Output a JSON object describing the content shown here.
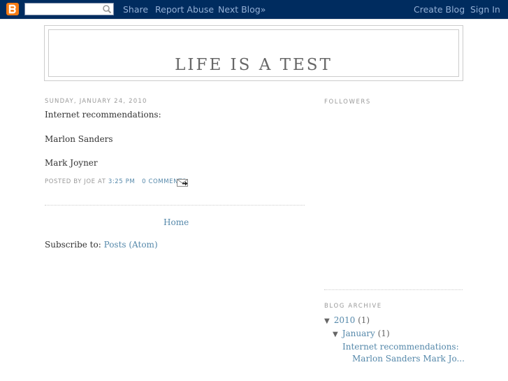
{
  "navbar": {
    "logo_icon": "blogger-logo-icon",
    "search": {
      "value": "",
      "placeholder": "",
      "icon": "search-icon"
    },
    "links": [
      "Share",
      "Report Abuse",
      "Next Blog»"
    ],
    "right_links": [
      "Create Blog",
      "Sign In"
    ],
    "colors": {
      "background": "#002c5f",
      "link": "#94b0d6",
      "logo": "#f47b14"
    }
  },
  "header": {
    "title": "LIFE IS A TEST"
  },
  "post": {
    "date": "Sunday, January 24, 2010",
    "lines": [
      "Internet recommendations:",
      "Marlon Sanders",
      "Mark Joyner"
    ],
    "footer": {
      "posted_by": "Posted by Joe at",
      "time": "3:25 PM",
      "comments": "0 Comments",
      "email_icon": "email-post-icon"
    }
  },
  "home_link": "Home",
  "subscribe": {
    "label": "Subscribe to:",
    "link": "Posts (Atom)"
  },
  "sidebar": {
    "followers_title": "Followers",
    "archive_title": "Blog Archive",
    "archive": {
      "year": "2010",
      "year_count": "(1)",
      "month": "January",
      "month_count": "(1)",
      "toggle_icon": "▼",
      "post_title_line1": "Internet recommendations:",
      "post_title_line2": "Marlon Sanders Mark Jo..."
    }
  },
  "colors": {
    "link": "#5588aa",
    "text": "#333333",
    "muted": "#999999",
    "border": "#cccccc"
  }
}
